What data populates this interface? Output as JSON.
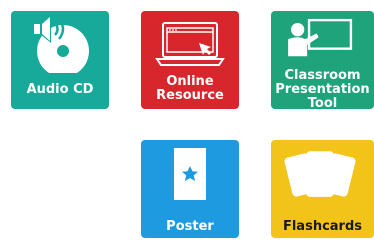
{
  "colors": {
    "audio": "#17a99a",
    "online": "#d7262c",
    "classroom": "#1fa37a",
    "poster": "#1e9be0",
    "flashcards": "#f2c318",
    "poster_star": "#1e9be0"
  },
  "tiles": {
    "audio": {
      "label_lines": [
        "Audio CD"
      ],
      "icon": "audio-cd-icon"
    },
    "online": {
      "label_lines": [
        "Online",
        "Resource"
      ],
      "icon": "laptop-browser-icon"
    },
    "classroom": {
      "label_lines": [
        "Classroom",
        "Presentation",
        "Tool"
      ],
      "icon": "presenter-whiteboard-icon"
    },
    "poster": {
      "label_lines": [
        "Poster"
      ],
      "icon": "poster-star-icon"
    },
    "flashcards": {
      "label_lines": [
        "Flashcards"
      ],
      "icon": "flashcards-icon"
    }
  }
}
